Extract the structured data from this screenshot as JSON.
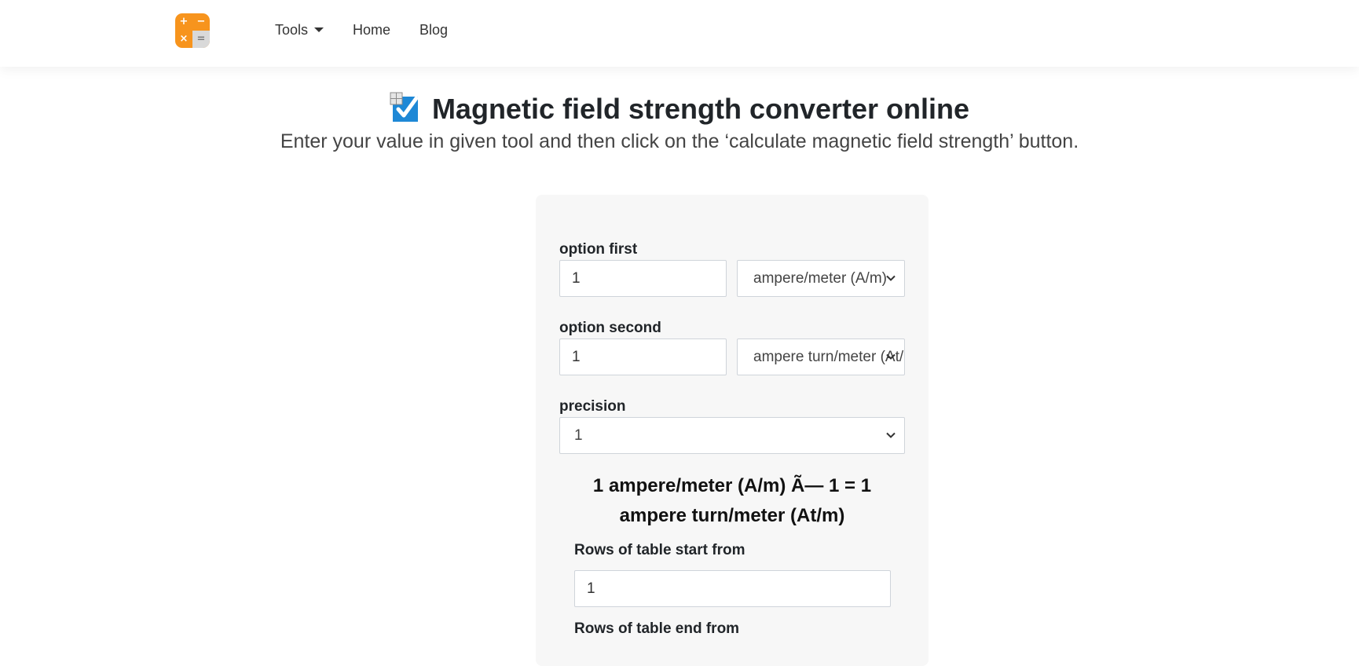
{
  "nav": {
    "logo_symbols": [
      "+",
      "−",
      "×",
      "="
    ],
    "tools": "Tools",
    "home": "Home",
    "blog": "Blog"
  },
  "page": {
    "title": "Magnetic field strength converter online",
    "subtitle": "Enter your value in given tool and then click on the ‘calculate magnetic field strength’ button."
  },
  "form": {
    "option_first_label": "option first",
    "option_first_value": "1",
    "option_first_unit": "ampere/meter (A/m)",
    "option_second_label": "option second",
    "option_second_value": "1",
    "option_second_unit": "ampere turn/meter (At/m)",
    "precision_label": "precision",
    "precision_value": "1",
    "result_line1": "1 ampere/meter (A/m) Ã— 1 = 1",
    "result_line2": "ampere turn/meter (At/m)",
    "rows_start_label": "Rows of table start from",
    "rows_start_value": "1",
    "rows_end_label": "Rows of table end from"
  },
  "colors": {
    "logo": "#f7941d",
    "card_bg": "#f7f7f7",
    "check_icon": "#1e88d6"
  }
}
